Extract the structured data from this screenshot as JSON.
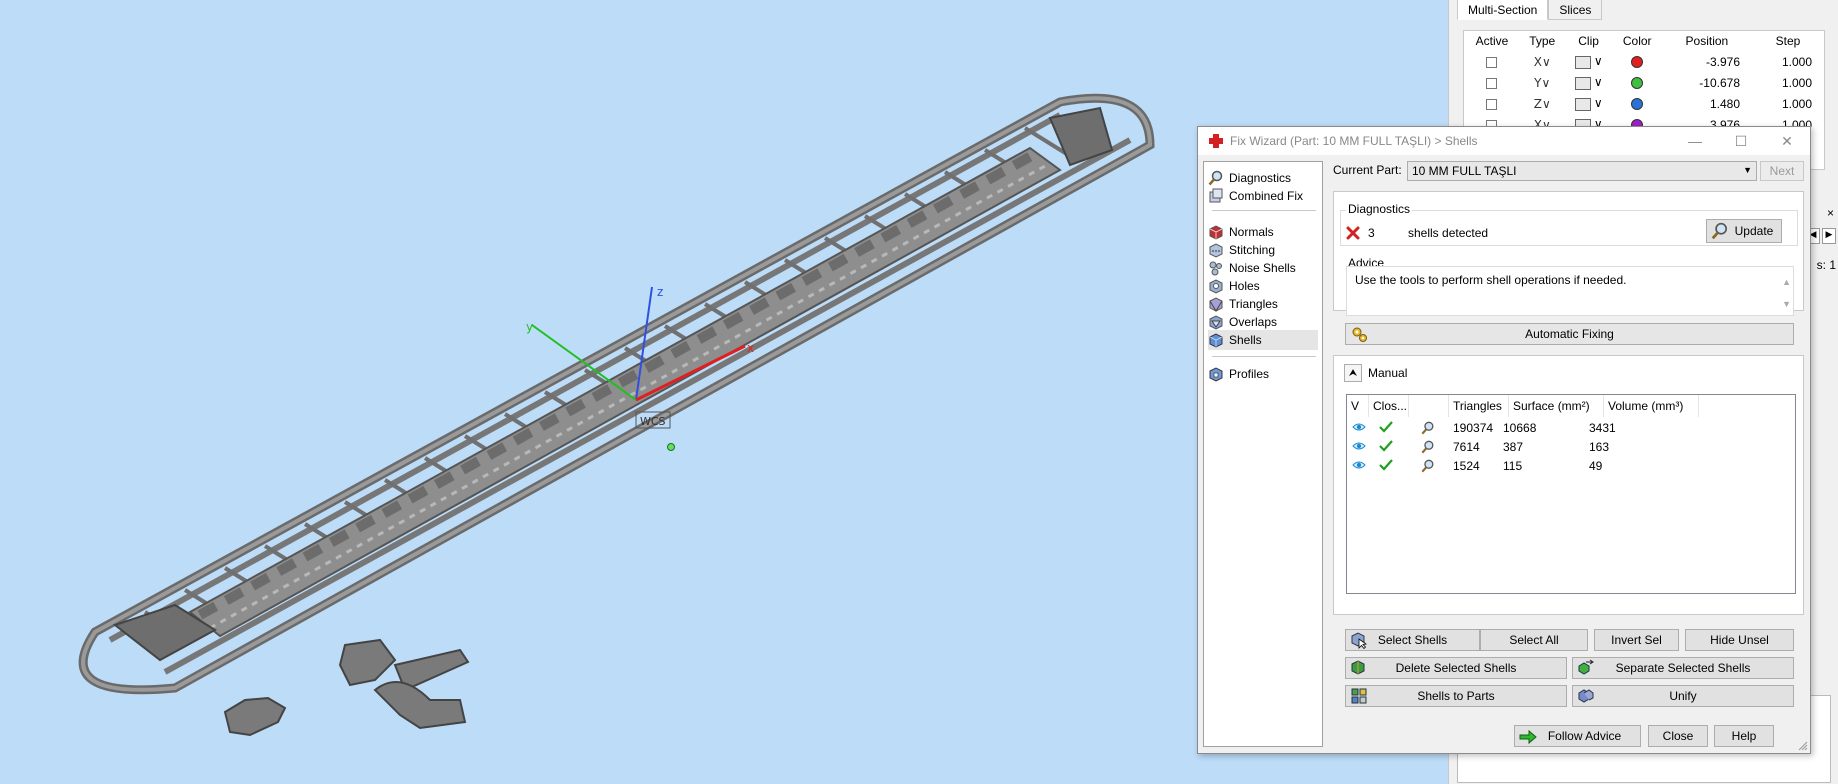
{
  "viewport": {
    "wcs_label": "WCS",
    "axes": {
      "x": "x",
      "y": "y",
      "z": "z"
    }
  },
  "right_panel": {
    "tabs": [
      "Multi-Section",
      "Slices"
    ],
    "table": {
      "headers": [
        "Active",
        "Type",
        "Clip",
        "Color",
        "Position",
        "Step"
      ],
      "rows": [
        {
          "type": "X∨",
          "color": "#e02020",
          "position": "-3.976",
          "step": "1.000"
        },
        {
          "type": "Y∨",
          "color": "#40c040",
          "position": "-10.678",
          "step": "1.000"
        },
        {
          "type": "Z∨",
          "color": "#2a72d8",
          "position": "1.480",
          "step": "1.000"
        },
        {
          "type": "X∨",
          "color": "#a020c8",
          "position": "3.976",
          "step": "1.000"
        }
      ]
    },
    "edge_close": "×",
    "edge_text": "s: 1"
  },
  "dialog": {
    "title": "Fix Wizard (Part: 10 MM FULL TAŞLI) > Shells",
    "window_buttons": {
      "minimize": "—",
      "maximize": "☐",
      "close": "✕"
    },
    "nav": {
      "items": [
        {
          "label": "Diagnostics",
          "icon": "magnifier-icon"
        },
        {
          "label": "Combined Fix",
          "icon": "combined-fix-icon"
        },
        {
          "label": "Normals",
          "icon": "normals-icon"
        },
        {
          "label": "Stitching",
          "icon": "stitching-icon"
        },
        {
          "label": "Noise Shells",
          "icon": "noise-shells-icon"
        },
        {
          "label": "Holes",
          "icon": "holes-icon"
        },
        {
          "label": "Triangles",
          "icon": "triangles-icon"
        },
        {
          "label": "Overlaps",
          "icon": "overlaps-icon"
        },
        {
          "label": "Shells",
          "icon": "shells-icon"
        },
        {
          "label": "Profiles",
          "icon": "profiles-icon"
        }
      ]
    },
    "current_part": {
      "label": "Current Part:",
      "value": "10 MM FULL TAŞLI",
      "next": "Next"
    },
    "diagnostics": {
      "title": "Diagnostics",
      "count": "3",
      "text": "shells detected",
      "update": "Update"
    },
    "advice": {
      "title": "Advice",
      "text": "Use the tools to perform shell operations if needed."
    },
    "automatic_fixing": "Automatic Fixing",
    "manual": {
      "title": "Manual",
      "columns": [
        "V",
        "Clos...",
        "",
        "Triangles",
        "Surface (mm²)",
        "Volume (mm³)"
      ],
      "rows": [
        {
          "triangles": "190374",
          "surface": "10668",
          "volume": "3431"
        },
        {
          "triangles": "7614",
          "surface": "387",
          "volume": "163"
        },
        {
          "triangles": "1524",
          "surface": "115",
          "volume": "49"
        }
      ]
    },
    "buttons": {
      "select_shells": "Select Shells",
      "select_all": "Select All",
      "invert_sel": "Invert Sel",
      "hide_unsel": "Hide Unsel",
      "delete_selected": "Delete Selected Shells",
      "separate_selected": "Separate Selected Shells",
      "shells_to_parts": "Shells to Parts",
      "unify": "Unify",
      "follow_advice": "Follow Advice",
      "close": "Close",
      "help": "Help"
    }
  }
}
